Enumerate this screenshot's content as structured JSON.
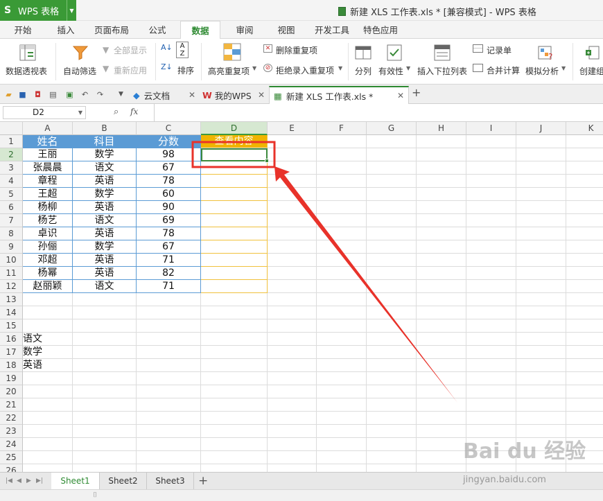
{
  "app": {
    "name": "WPS 表格",
    "doc_title": "新建 XLS 工作表.xls * [兼容模式] - WPS 表格"
  },
  "menu": [
    "开始",
    "插入",
    "页面布局",
    "公式",
    "数据",
    "审阅",
    "视图",
    "开发工具",
    "特色应用"
  ],
  "ribbon": {
    "pivot": "数据透视表",
    "autofilter": "自动筛选",
    "show_all": "全部显示",
    "reapply": "重新应用",
    "sort": "排序",
    "highlight_dup": "高亮重复项",
    "delete_dup": "删除重复项",
    "reject_dup": "拒绝录入重复项",
    "split": "分列",
    "validation": "有效性",
    "dropdown": "插入下拉列表",
    "record": "记录单",
    "consolidate": "合并计算",
    "simulate": "模拟分析",
    "create_group": "创建组"
  },
  "doc_tabs": [
    "云文档",
    "我的WPS",
    "新建 XLS 工作表.xls *"
  ],
  "namebox": "D2",
  "fx": "fx",
  "columns": [
    "A",
    "B",
    "C",
    "D",
    "E",
    "F",
    "G",
    "H",
    "I",
    "J",
    "K"
  ],
  "rows": [
    "1",
    "2",
    "3",
    "4",
    "5",
    "6",
    "7",
    "8",
    "9",
    "10",
    "11",
    "12",
    "13",
    "14",
    "15",
    "16",
    "17",
    "18",
    "19",
    "20",
    "21",
    "22",
    "23",
    "24",
    "25",
    "26"
  ],
  "table": {
    "headers": [
      "姓名",
      "科目",
      "分数"
    ],
    "lookup_header": "查看内容",
    "data": [
      [
        "王丽",
        "数学",
        "98"
      ],
      [
        "张晨晨",
        "语文",
        "67"
      ],
      [
        "章程",
        "英语",
        "78"
      ],
      [
        "王超",
        "数学",
        "60"
      ],
      [
        "杨柳",
        "英语",
        "90"
      ],
      [
        "杨艺",
        "语文",
        "69"
      ],
      [
        "卓识",
        "英语",
        "78"
      ],
      [
        "孙俪",
        "数学",
        "67"
      ],
      [
        "邓超",
        "英语",
        "71"
      ],
      [
        "杨幂",
        "英语",
        "82"
      ],
      [
        "赵丽颖",
        "语文",
        "71"
      ]
    ]
  },
  "subject_list": [
    "语文",
    "数学",
    "英语"
  ],
  "sheets": [
    "Sheet1",
    "Sheet2",
    "Sheet3"
  ],
  "watermark": "Bai du 经验",
  "watermark_url": "jingyan.baidu.com",
  "colors": {
    "accent": "#3a9a36",
    "header_blue": "#5b9bd5",
    "header_orange": "#f0b400",
    "annotation_red": "#e8322a"
  }
}
